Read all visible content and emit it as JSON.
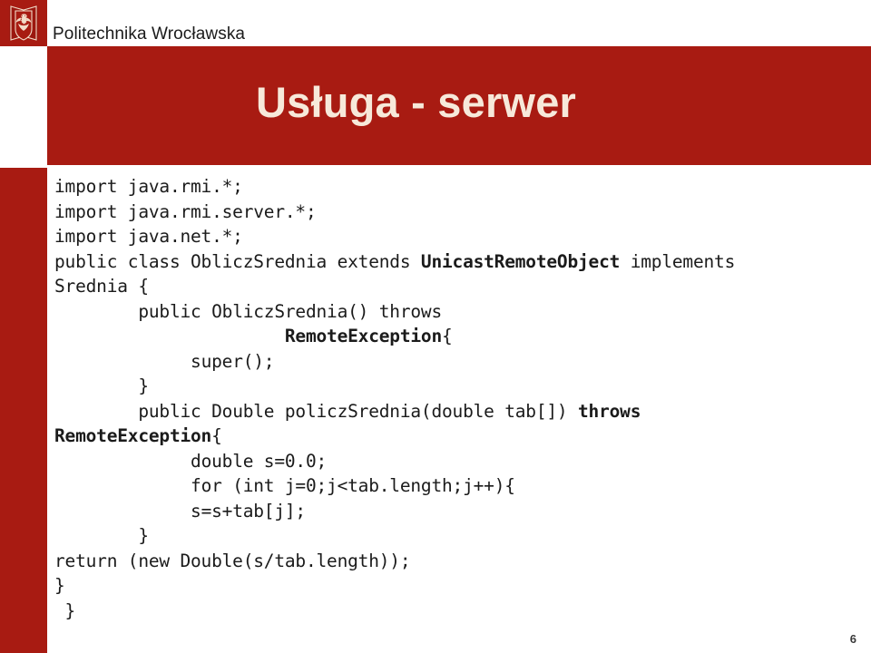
{
  "header": {
    "institution": "Politechnika Wrocławska",
    "logo_icon": "wroclaw-university-crest-icon"
  },
  "title": {
    "text": "Usługa - serwer"
  },
  "colors": {
    "brand_red": "#A81B12",
    "title_text": "#F7E9DA",
    "code_text": "#1b1b1b",
    "page_background": "#FFFFFF"
  },
  "code": {
    "language": "java",
    "lines": [
      {
        "indent": 0,
        "segments": [
          {
            "text": "import java.rmi.*;",
            "bold": false
          }
        ]
      },
      {
        "indent": 0,
        "segments": [
          {
            "text": "import java.rmi.server.*;",
            "bold": false
          }
        ]
      },
      {
        "indent": 0,
        "segments": [
          {
            "text": "import java.net.*;",
            "bold": false
          }
        ]
      },
      {
        "indent": 0,
        "segments": [
          {
            "text": "public class ObliczSrednia extends ",
            "bold": false
          },
          {
            "text": "UnicastRemoteObject",
            "bold": true
          },
          {
            "text": " implements",
            "bold": false
          }
        ]
      },
      {
        "indent": 0,
        "segments": [
          {
            "text": "Srednia {",
            "bold": false
          }
        ]
      },
      {
        "indent": 8,
        "segments": [
          {
            "text": "public ObliczSrednia() throws",
            "bold": false
          }
        ]
      },
      {
        "indent": 22,
        "segments": [
          {
            "text": "RemoteException",
            "bold": true
          },
          {
            "text": "{",
            "bold": false
          }
        ]
      },
      {
        "indent": 13,
        "segments": [
          {
            "text": "super();",
            "bold": false
          }
        ]
      },
      {
        "indent": 8,
        "segments": [
          {
            "text": "}",
            "bold": false
          }
        ]
      },
      {
        "indent": 8,
        "segments": [
          {
            "text": "public Double policzSrednia(double tab[]) ",
            "bold": false
          },
          {
            "text": "throws",
            "bold": true
          }
        ]
      },
      {
        "indent": 0,
        "segments": [
          {
            "text": "RemoteException",
            "bold": true
          },
          {
            "text": "{",
            "bold": false
          }
        ]
      },
      {
        "indent": 13,
        "segments": [
          {
            "text": "double s=0.0;",
            "bold": false
          }
        ]
      },
      {
        "indent": 13,
        "segments": [
          {
            "text": "for (int j=0;j<tab.length;j++){",
            "bold": false
          }
        ]
      },
      {
        "indent": 13,
        "segments": [
          {
            "text": "s=s+tab[j];",
            "bold": false
          }
        ]
      },
      {
        "indent": 8,
        "segments": [
          {
            "text": "}",
            "bold": false
          }
        ]
      },
      {
        "indent": 0,
        "segments": [
          {
            "text": "return (new Double(s/tab.length));",
            "bold": false
          }
        ]
      },
      {
        "indent": 0,
        "segments": [
          {
            "text": "}",
            "bold": false
          }
        ]
      },
      {
        "indent": 1,
        "segments": [
          {
            "text": "}",
            "bold": false
          }
        ]
      }
    ]
  },
  "footer": {
    "page_number": "6"
  }
}
